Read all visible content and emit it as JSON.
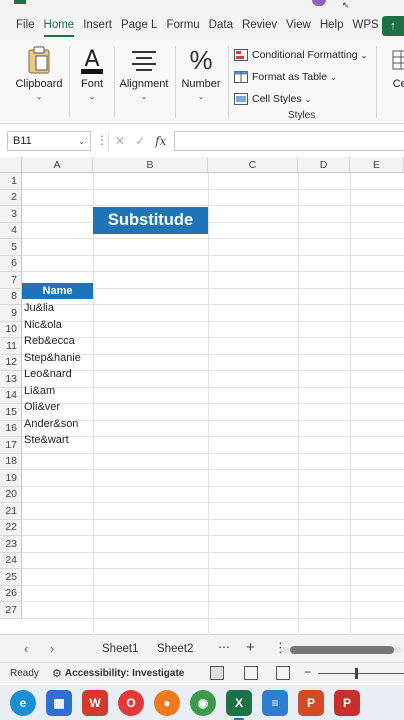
{
  "ribbon": {
    "tabs": [
      "File",
      "Home",
      "Insert",
      "Page L",
      "Formu",
      "Data",
      "Reviev",
      "View",
      "Help",
      "WPS P"
    ],
    "active_tab": "Home",
    "groups": {
      "clipboard": "Clipboard",
      "font": "Font",
      "alignment": "Alignment",
      "number": "Number",
      "cells": "Cel"
    },
    "styles": {
      "conditional_formatting": "Conditional Formatting",
      "format_as_table": "Format as Table",
      "cell_styles": "Cell Styles",
      "group_label": "Styles"
    },
    "accent_color": "#1e7145"
  },
  "formula_bar": {
    "name_box": "B11",
    "fx_label": "fx",
    "value": ""
  },
  "sheet": {
    "columns": [
      "A",
      "B",
      "C",
      "D",
      "E"
    ],
    "rows": [
      "1",
      "2",
      "3",
      "4",
      "5",
      "6",
      "7",
      "8",
      "9",
      "10",
      "11",
      "12",
      "13",
      "14",
      "15",
      "16",
      "17",
      "18",
      "19",
      "20",
      "21",
      "22",
      "23",
      "24",
      "25",
      "26",
      "27"
    ],
    "title": "Substitude",
    "header": "Name",
    "names": [
      "Ju&lia",
      "Nic&ola",
      "Reb&ecca",
      "Step&hanie",
      "Leo&nard",
      "Li&am",
      "Oli&ver",
      "Ander&son",
      "Ste&wart"
    ],
    "fill_color": "#1f74b8"
  },
  "sheet_tabs": {
    "tabs": [
      "Sheet1",
      "Sheet2"
    ],
    "active": "Sheet1"
  },
  "status": {
    "ready": "Ready",
    "accessibility": "Accessibility: Investigate"
  },
  "taskbar": {
    "apps": [
      "edge-icon",
      "store-icon",
      "wps-icon",
      "opera-icon",
      "firefox-icon",
      "chrome-icon",
      "excel-icon",
      "notepad-icon",
      "wps-presentation-icon",
      "wps-pdf-icon",
      "powerpoint-icon"
    ]
  }
}
